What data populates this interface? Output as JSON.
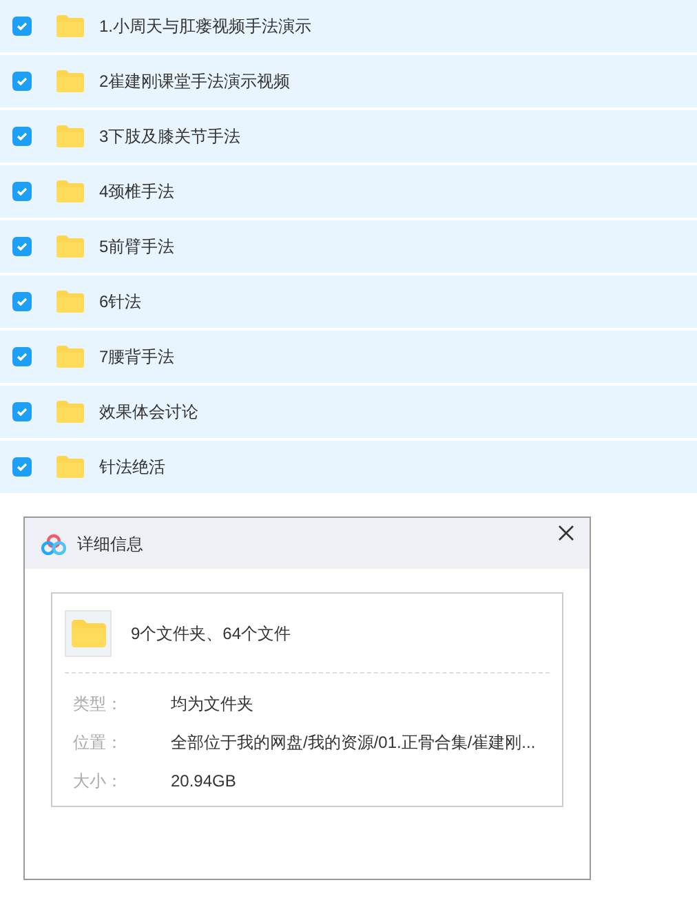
{
  "files": [
    {
      "name": "1.小周天与肛瘘视频手法演示",
      "checked": true
    },
    {
      "name": "2崔建刚课堂手法演示视频",
      "checked": true
    },
    {
      "name": "3下肢及膝关节手法",
      "checked": true
    },
    {
      "name": "4颈椎手法",
      "checked": true
    },
    {
      "name": "5前臂手法",
      "checked": true
    },
    {
      "name": "6针法",
      "checked": true
    },
    {
      "name": "7腰背手法",
      "checked": true
    },
    {
      "name": "效果体会讨论",
      "checked": true
    },
    {
      "name": "针法绝活",
      "checked": true
    }
  ],
  "dialog": {
    "title": "详细信息",
    "summary": "9个文件夹、64个文件",
    "details": [
      {
        "label": "类型：",
        "value": "均为文件夹"
      },
      {
        "label": "位置：",
        "value": "全部位于我的网盘/我的资源/01.正骨合集/崔建刚..."
      },
      {
        "label": "大小：",
        "value": "20.94GB"
      }
    ]
  }
}
